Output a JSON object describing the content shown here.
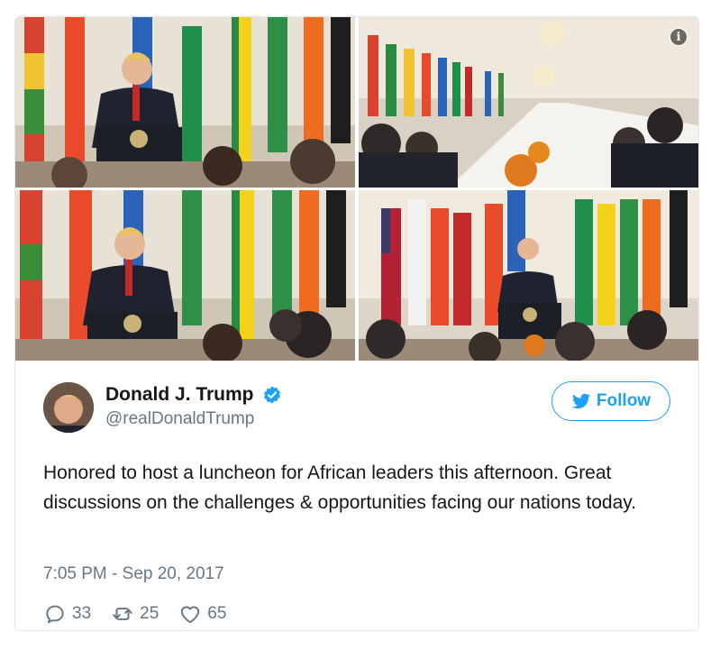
{
  "tweet": {
    "display_name": "Donald J. Trump",
    "handle": "@realDonaldTrump",
    "verified": true,
    "follow_label": "Follow",
    "text": "Honored to host a luncheon for African leaders this afternoon. Great discussions on the challenges & opportunities facing our nations today.",
    "timestamp": "7:05 PM - Sep 20, 2017",
    "counts": {
      "replies": "33",
      "retweets": "25",
      "likes": "65"
    }
  },
  "icons": {
    "info": "info-icon",
    "verified": "verified-badge-icon",
    "twitter": "twitter-bird-icon",
    "reply": "reply-icon",
    "retweet": "retweet-icon",
    "like": "heart-icon"
  },
  "colors": {
    "brand_blue": "#1da1f2",
    "secondary_text": "#657786",
    "border": "#e1e8ed"
  },
  "info_glyph": "i"
}
